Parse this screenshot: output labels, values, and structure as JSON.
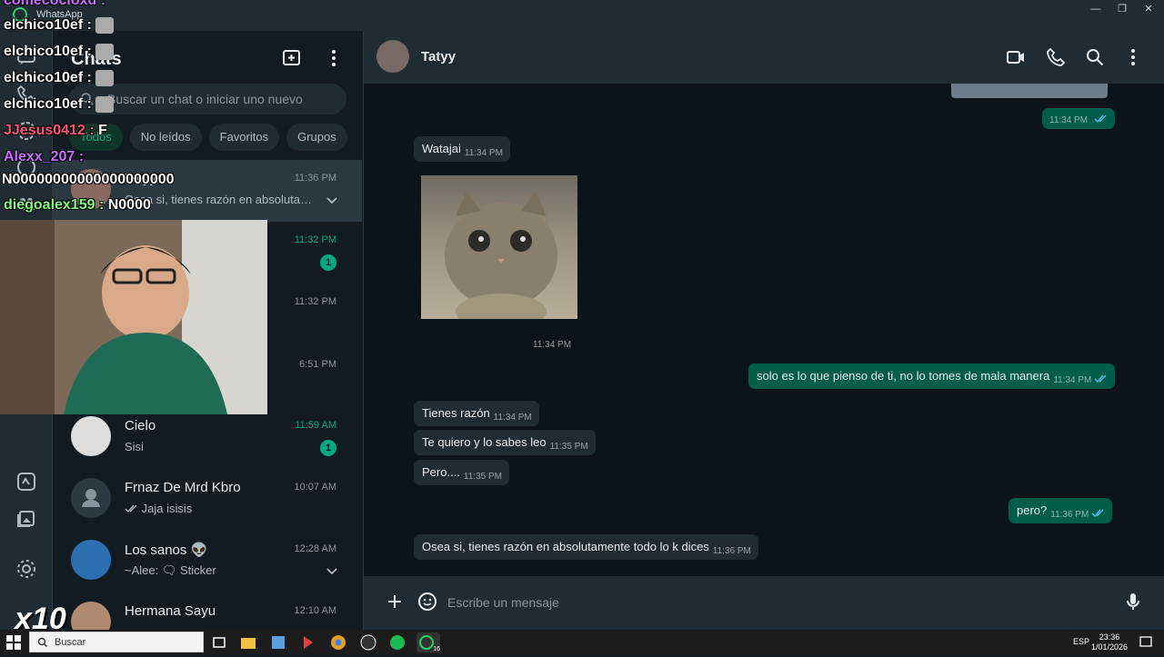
{
  "window": {
    "title": "WhatsApp"
  },
  "chatlist": {
    "title": "Chats",
    "search_placeholder": "Buscar un chat o iniciar uno nuevo",
    "filters": [
      "Todos",
      "No leídos",
      "Favoritos",
      "Grupos"
    ],
    "items": [
      {
        "name": "Tatyy",
        "time": "11:36 PM",
        "preview": "Osea si, tienes razón en absolutam...",
        "unread": ""
      },
      {
        "name": "",
        "time": "11:32 PM",
        "preview": "",
        "unread": "1"
      },
      {
        "name": "",
        "time": "11:32 PM",
        "preview": "",
        "unread": ""
      },
      {
        "name": "",
        "time": "6:51 PM",
        "preview": "",
        "unread": ""
      },
      {
        "name": "Cielo",
        "time": "11:59 AM",
        "preview": "Sisi",
        "unread": "1"
      },
      {
        "name": "Frnaz De Mrd Kbro",
        "time": "10:07 AM",
        "preview": "Jaja isisis",
        "unread": ""
      },
      {
        "name": "Los sanos 👽",
        "time": "12:28 AM",
        "preview": "~Alee: 🗨 Sticker",
        "unread": ""
      },
      {
        "name": "Hermana Sayu",
        "time": "12:10 AM",
        "preview": "",
        "unread": ""
      }
    ]
  },
  "conversation": {
    "contact": "Tatyy",
    "messages": [
      {
        "dir": "out",
        "text": "",
        "time": "11:34 PM"
      },
      {
        "dir": "in",
        "text": "Watajai",
        "time": "11:34 PM"
      },
      {
        "dir": "in",
        "text": "",
        "time": "11:34 PM"
      },
      {
        "dir": "out",
        "text": "solo es lo que pienso de ti, no lo tomes de mala manera",
        "time": "11:34 PM"
      },
      {
        "dir": "in",
        "text": "Tienes razón",
        "time": "11:34 PM"
      },
      {
        "dir": "in",
        "text": "Te quiero y lo sabes leo",
        "time": "11:35 PM"
      },
      {
        "dir": "in",
        "text": "Pero....",
        "time": "11:35 PM"
      },
      {
        "dir": "out",
        "text": "pero?",
        "time": "11:36 PM"
      },
      {
        "dir": "in",
        "text": "Osea si, tienes razón en absolutamente todo lo k dices",
        "time": "11:36 PM"
      }
    ],
    "composer_placeholder": "Escribe un mensaje"
  },
  "stream_overlay": {
    "chat_lines": [
      {
        "user": "comecocioxd",
        "msg": "",
        "color": "#c86bff"
      },
      {
        "user": "elchico10ef",
        "msg": "",
        "color": "#ffffff"
      },
      {
        "user": "elchico10ef",
        "msg": "",
        "color": "#ffffff"
      },
      {
        "user": "elchico10ef",
        "msg": "",
        "color": "#ffffff"
      },
      {
        "user": "elchico10ef",
        "msg": "",
        "color": "#ffffff"
      },
      {
        "user": "JJesus0412",
        "msg": "F",
        "color": "#ff5577"
      },
      {
        "user": "Alexx_207",
        "msg": "",
        "color": "#c86bff"
      },
      {
        "user": "",
        "msg": "N00000000000000000000",
        "color": "#ffffff"
      },
      {
        "user": "diegoalex159",
        "msg": "N0000",
        "color": "#7dff7d"
      }
    ],
    "multiplier": "x10"
  },
  "taskbar": {
    "search_label": "Buscar",
    "language": "ESP",
    "time": "23:36",
    "date": "1/01/2026",
    "whatsapp_badge": "16"
  },
  "colors": {
    "accent": "#00a884",
    "outgoing": "#005c4b",
    "incoming": "#202c33",
    "background": "#0b141a"
  }
}
